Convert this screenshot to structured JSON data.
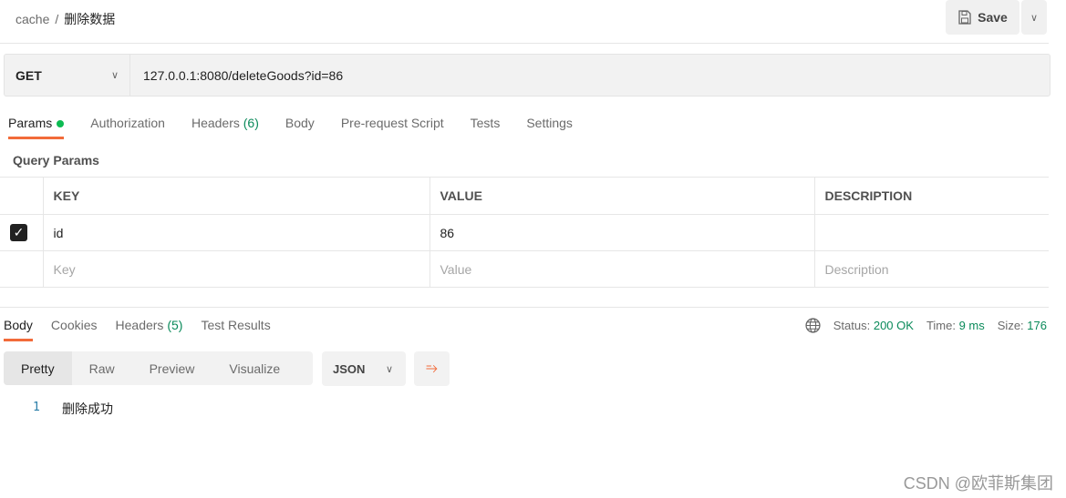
{
  "breadcrumb": {
    "collection": "cache",
    "separator": "/",
    "request": "删除数据"
  },
  "toolbar": {
    "save_label": "Save"
  },
  "request": {
    "method": "GET",
    "url": "127.0.0.1:8080/deleteGoods?id=86"
  },
  "request_tabs": [
    {
      "label": "Params"
    },
    {
      "label": "Authorization"
    },
    {
      "label": "Headers",
      "count": "(6)"
    },
    {
      "label": "Body"
    },
    {
      "label": "Pre-request Script"
    },
    {
      "label": "Tests"
    },
    {
      "label": "Settings"
    }
  ],
  "query_params": {
    "title": "Query Params",
    "headers": [
      "KEY",
      "VALUE",
      "DESCRIPTION"
    ],
    "rows": [
      {
        "checked": true,
        "key": "id",
        "value": "86",
        "description": ""
      }
    ],
    "placeholders": {
      "key": "Key",
      "value": "Value",
      "description": "Description"
    }
  },
  "response_tabs": [
    {
      "label": "Body"
    },
    {
      "label": "Cookies"
    },
    {
      "label": "Headers",
      "count": "(5)"
    },
    {
      "label": "Test Results"
    }
  ],
  "status": {
    "status_label": "Status:",
    "status_value": "200 OK",
    "time_label": "Time:",
    "time_value": "9 ms",
    "size_label": "Size:",
    "size_value": "176"
  },
  "view_modes": [
    "Pretty",
    "Raw",
    "Preview",
    "Visualize"
  ],
  "format": "JSON",
  "response_body": [
    {
      "line": "1",
      "text": "删除成功"
    }
  ],
  "watermark": "CSDN @欧菲斯集团",
  "colors": {
    "accent": "#f26b3a",
    "success": "#0a8a5a",
    "dot": "#0cbb52"
  }
}
